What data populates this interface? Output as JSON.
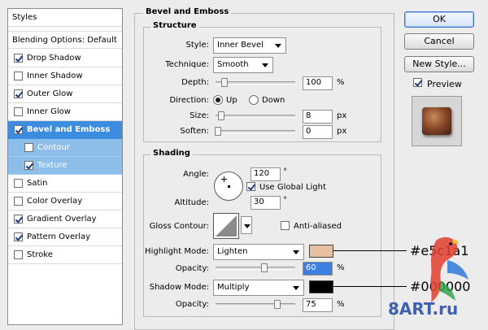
{
  "styles_panel": {
    "header": "Styles",
    "blending": "Blending Options: Default",
    "items": [
      {
        "label": "Drop Shadow",
        "checked": true
      },
      {
        "label": "Inner Shadow",
        "checked": false
      },
      {
        "label": "Outer Glow",
        "checked": true
      },
      {
        "label": "Inner Glow",
        "checked": false
      },
      {
        "label": "Bevel and Emboss",
        "checked": true
      },
      {
        "label": "Contour",
        "checked": false
      },
      {
        "label": "Texture",
        "checked": true
      },
      {
        "label": "Satin",
        "checked": false
      },
      {
        "label": "Color Overlay",
        "checked": false
      },
      {
        "label": "Gradient Overlay",
        "checked": true
      },
      {
        "label": "Pattern Overlay",
        "checked": true
      },
      {
        "label": "Stroke",
        "checked": false
      }
    ]
  },
  "bevel": {
    "title": "Bevel and Emboss",
    "structure": {
      "title": "Structure",
      "style_label": "Style:",
      "style_value": "Inner Bevel",
      "technique_label": "Technique:",
      "technique_value": "Smooth",
      "depth_label": "Depth:",
      "depth_value": "100",
      "depth_unit": "%",
      "direction_label": "Direction:",
      "up_label": "Up",
      "down_label": "Down",
      "size_label": "Size:",
      "size_value": "8",
      "size_unit": "px",
      "soften_label": "Soften:",
      "soften_value": "0",
      "soften_unit": "px"
    },
    "shading": {
      "title": "Shading",
      "angle_label": "Angle:",
      "angle_value": "120",
      "angle_unit": "°",
      "global_light_label": "Use Global Light",
      "altitude_label": "Altitude:",
      "altitude_value": "30",
      "altitude_unit": "°",
      "gloss_label": "Gloss Contour:",
      "antialias_label": "Anti-aliased",
      "highlight_label": "Highlight Mode:",
      "highlight_mode": "Lighten",
      "highlight_color": "#e5c1a1",
      "opacity_label": "Opacity:",
      "highlight_opacity": "60",
      "opacity_unit": "%",
      "shadow_label": "Shadow Mode:",
      "shadow_mode": "Multiply",
      "shadow_color": "#000000",
      "shadow_opacity_label": "Opacity:",
      "shadow_opacity": "75",
      "shadow_opacity_unit": "%"
    }
  },
  "buttons": {
    "ok": "OK",
    "cancel": "Cancel",
    "new_style": "New Style...",
    "preview": "Preview"
  },
  "annotations": {
    "highlight_hex": "#e5c1a1",
    "shadow_hex": "#000000",
    "watermark": "8ART.ru"
  }
}
